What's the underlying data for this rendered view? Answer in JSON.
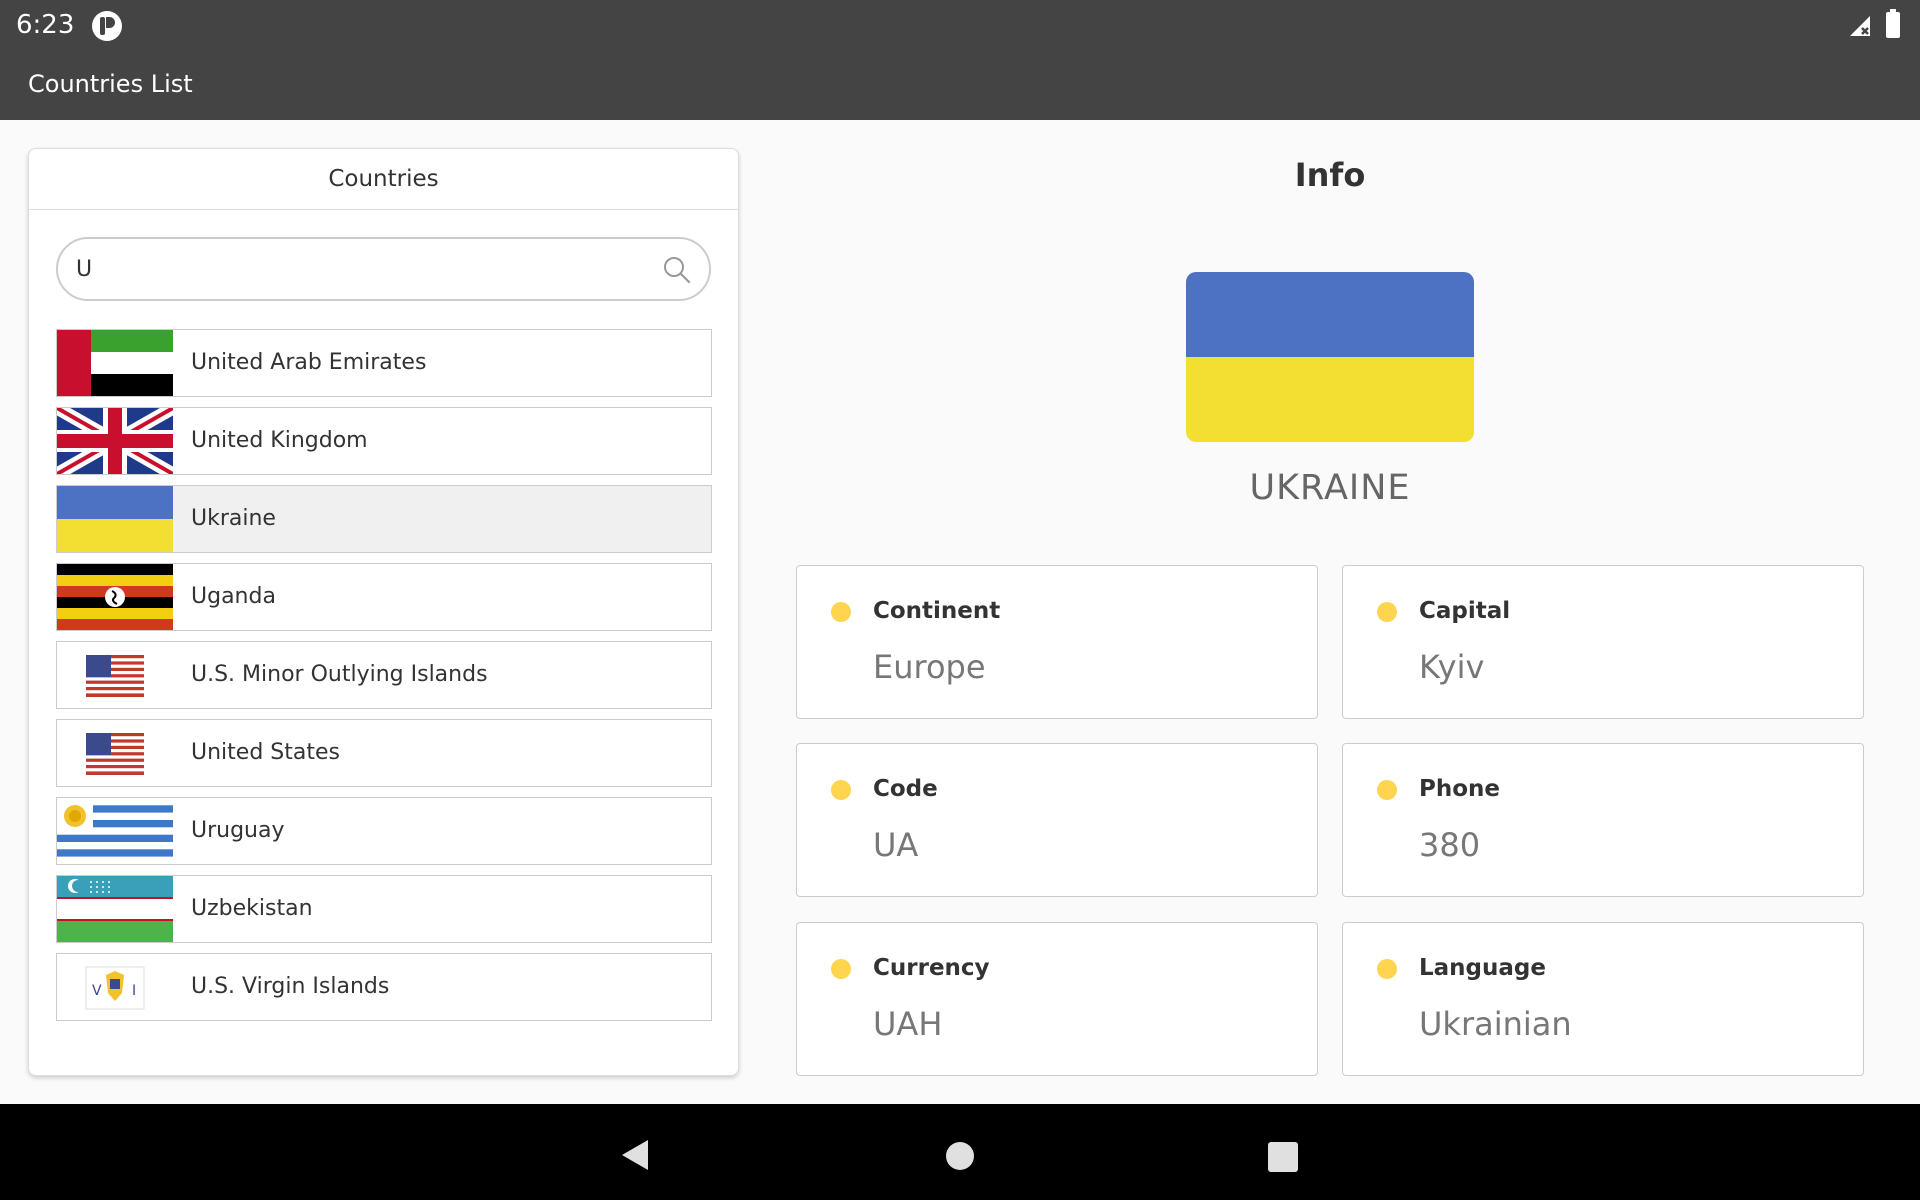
{
  "status_bar": {
    "time": "6:23"
  },
  "app_bar": {
    "title": "Countries List"
  },
  "countries_panel": {
    "header": "Countries",
    "search": {
      "value": "U",
      "placeholder": ""
    },
    "items": [
      {
        "name": "United Arab Emirates",
        "flag": "uae-flag",
        "selected": false
      },
      {
        "name": "United Kingdom",
        "flag": "uk-flag",
        "selected": false
      },
      {
        "name": "Ukraine",
        "flag": "ukraine-flag",
        "selected": true
      },
      {
        "name": "Uganda",
        "flag": "uganda-flag",
        "selected": false
      },
      {
        "name": "U.S. Minor Outlying Islands",
        "flag": "us-flag",
        "selected": false
      },
      {
        "name": "United States",
        "flag": "us-flag",
        "selected": false
      },
      {
        "name": "Uruguay",
        "flag": "uruguay-flag",
        "selected": false
      },
      {
        "name": "Uzbekistan",
        "flag": "uzbekistan-flag",
        "selected": false
      },
      {
        "name": "U.S. Virgin Islands",
        "flag": "usvi-flag",
        "selected": false
      }
    ]
  },
  "info": {
    "title": "Info",
    "country": "UKRAINE",
    "flag_colors": [
      "#4d72c4",
      "#f3df32"
    ],
    "cards": [
      {
        "label": "Continent",
        "value": "Europe"
      },
      {
        "label": "Capital",
        "value": "Kyiv"
      },
      {
        "label": "Code",
        "value": "UA"
      },
      {
        "label": "Phone",
        "value": "380"
      },
      {
        "label": "Currency",
        "value": "UAH"
      },
      {
        "label": "Language",
        "value": "Ukrainian"
      }
    ]
  },
  "colors": {
    "app_bar": "#444444",
    "accent_dot": "#ffd54f",
    "selected_row": "#f0f0f0"
  }
}
